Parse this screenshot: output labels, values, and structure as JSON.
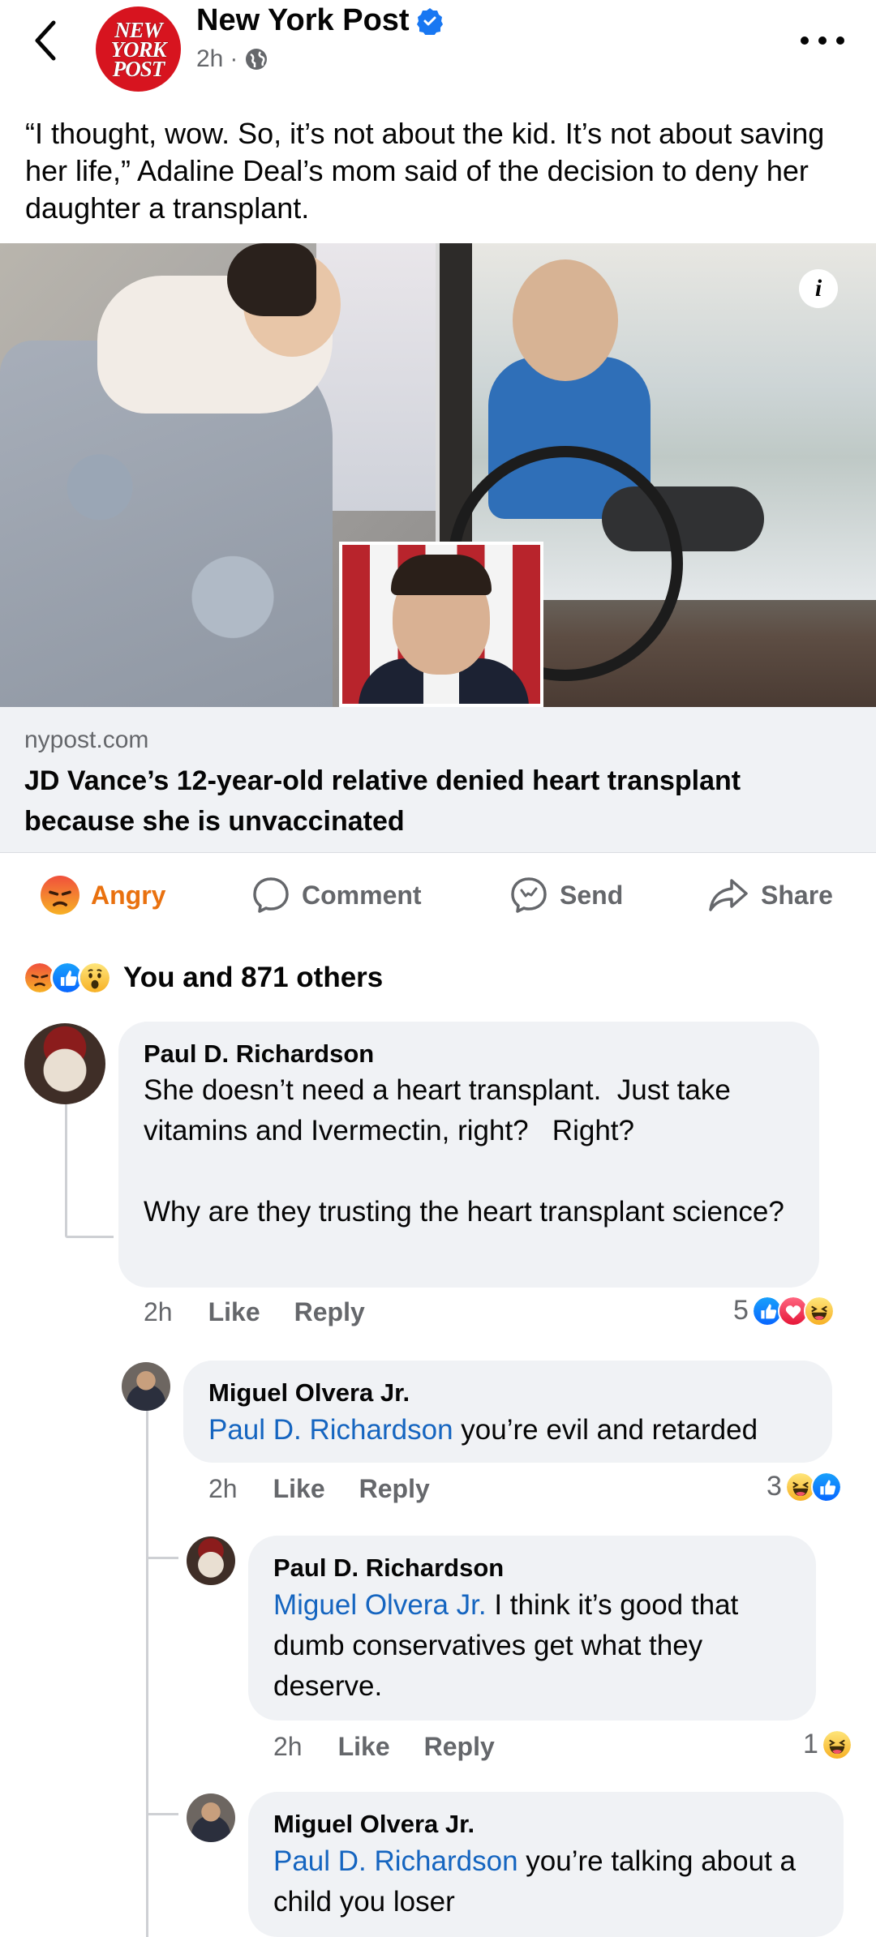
{
  "header": {
    "page_name": "New York Post",
    "logo_text": "NEW YORK POST",
    "time": "2h",
    "audience": "public",
    "back_icon": "chevron-left-icon",
    "more_icon": "more-dots-icon"
  },
  "post": {
    "text": "“I thought, wow. So, it’s not about the kid. It’s not about saving her life,” Adaline Deal’s mom said of the decision to deny her daughter a transplant."
  },
  "link_preview": {
    "domain": "nypost.com",
    "title": "JD Vance’s 12-year-old relative denied heart transplant because she is unvaccinated"
  },
  "actions": {
    "angry": "Angry",
    "comment": "Comment",
    "send": "Send",
    "share": "Share"
  },
  "reactions": {
    "summary": "You and 871 others",
    "icons": [
      "angry",
      "like",
      "wow"
    ]
  },
  "comments": [
    {
      "author": "Paul D. Richardson",
      "text": "She doesn’t need a heart transplant.  Just take vitamins and Ivermectin, right?   Right?\n\nWhy are they trusting the heart transplant science?",
      "time": "2h",
      "like": "Like",
      "reply": "Reply",
      "reaction_count": "5",
      "reaction_icons": [
        "like",
        "love",
        "haha"
      ]
    },
    {
      "author": "Miguel Olvera Jr.",
      "mention": "Paul D. Richardson",
      "text": " you’re evil and retarded",
      "time": "2h",
      "like": "Like",
      "reply": "Reply",
      "reaction_count": "3",
      "reaction_icons": [
        "haha",
        "like"
      ]
    },
    {
      "author": "Paul D. Richardson",
      "mention": "Miguel Olvera Jr.",
      "text": " I think it’s good that dumb conservatives get what they deserve.",
      "time": "2h",
      "like": "Like",
      "reply": "Reply",
      "reaction_count": "1",
      "reaction_icons": [
        "haha"
      ]
    },
    {
      "author": "Miguel Olvera Jr.",
      "mention": "Paul D. Richardson",
      "text": " you’re talking about a child you loser"
    }
  ],
  "colors": {
    "brand_red": "#d7141f",
    "verified_blue": "#1877f2",
    "angry_orange": "#e9710f",
    "mention_blue": "#1565c0",
    "bubble_gray": "#f0f2f5",
    "secondary_text": "#65676b"
  }
}
